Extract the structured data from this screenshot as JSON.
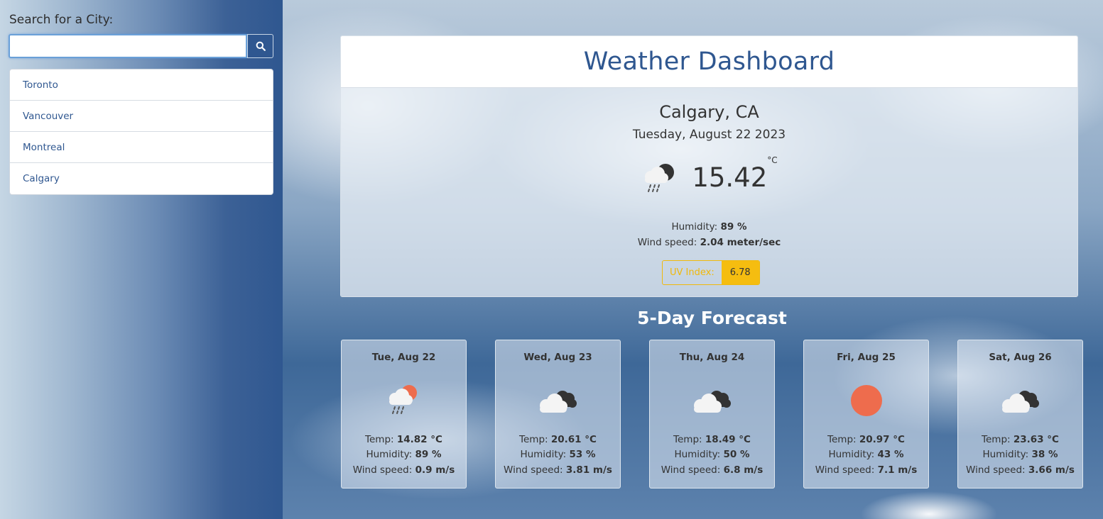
{
  "sidebar": {
    "search_label": "Search for a City:",
    "search_placeholder": "",
    "search_value": "",
    "search_button_icon": "search-icon",
    "cities": [
      {
        "label": "Toronto"
      },
      {
        "label": "Vancouver"
      },
      {
        "label": "Montreal"
      },
      {
        "label": "Calgary"
      }
    ]
  },
  "header": {
    "title": "Weather Dashboard"
  },
  "current": {
    "city": "Calgary, CA",
    "date": "Tuesday, August 22 2023",
    "icon": "rain-night-cloud-icon",
    "temp": "15.42",
    "temp_unit": "°C",
    "humidity_label": "Humidity:",
    "humidity_value": "89 %",
    "wind_label": "Wind speed:",
    "wind_value": "2.04 meter/sec",
    "uv_label": "UV Index:",
    "uv_value": "6.78"
  },
  "forecast": {
    "title": "5-Day Forecast",
    "temp_label": "Temp:",
    "humidity_label": "Humidity:",
    "wind_label": "Wind speed:",
    "days": [
      {
        "date": "Tue, Aug 22",
        "icon": "rain-sun-cloud-icon",
        "temp": "14.82 °C",
        "humidity": "89 %",
        "wind": "0.9 m/s"
      },
      {
        "date": "Wed, Aug 23",
        "icon": "broken-clouds-icon",
        "temp": "20.61 °C",
        "humidity": "53 %",
        "wind": "3.81 m/s"
      },
      {
        "date": "Thu, Aug 24",
        "icon": "broken-clouds-icon",
        "temp": "18.49 °C",
        "humidity": "50 %",
        "wind": "6.8 m/s"
      },
      {
        "date": "Fri, Aug 25",
        "icon": "sun-icon",
        "temp": "20.97 °C",
        "humidity": "43 %",
        "wind": "7.1 m/s"
      },
      {
        "date": "Sat, Aug 26",
        "icon": "broken-clouds-icon",
        "temp": "23.63 °C",
        "humidity": "38 %",
        "wind": "3.66 m/s"
      }
    ]
  },
  "colors": {
    "brand": "#2f5790",
    "uv_warning": "#f5bd10",
    "sun": "#ee6c4d"
  }
}
